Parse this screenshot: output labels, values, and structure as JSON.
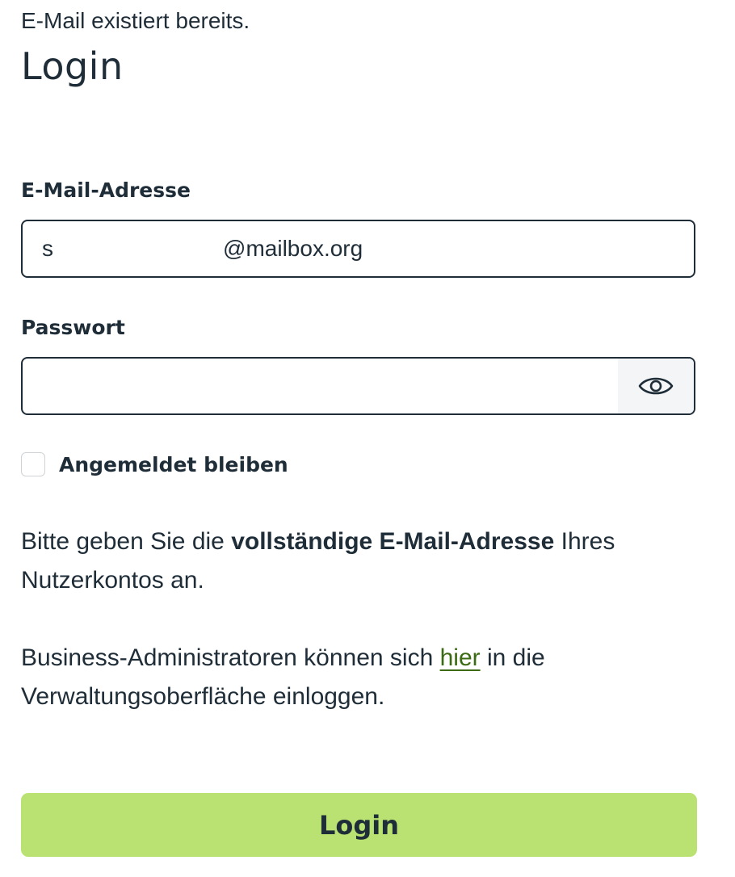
{
  "error": {
    "message": "E-Mail existiert bereits."
  },
  "page": {
    "title": "Login"
  },
  "form": {
    "email": {
      "label": "E-Mail-Adresse",
      "value": "s                           @mailbox.org"
    },
    "password": {
      "label": "Passwort",
      "value": "",
      "toggle_icon": "eye-icon"
    },
    "remember": {
      "label": "Angemeldet bleiben",
      "checked": false
    }
  },
  "info": {
    "p1_before": "Bitte geben Sie die ",
    "p1_bold": "vollständige E-Mail-Adresse",
    "p1_after": " Ihres Nutzerkontos an.",
    "p2_before": "Business-Administratoren können sich ",
    "p2_link": "hier",
    "p2_after": " in die Verwaltungsoberfläche einloggen."
  },
  "actions": {
    "login_label": "Login"
  },
  "colors": {
    "text": "#1f2d38",
    "link": "#3b6b13",
    "button": "#b9e272",
    "eye_bg": "#f4f5f6"
  }
}
